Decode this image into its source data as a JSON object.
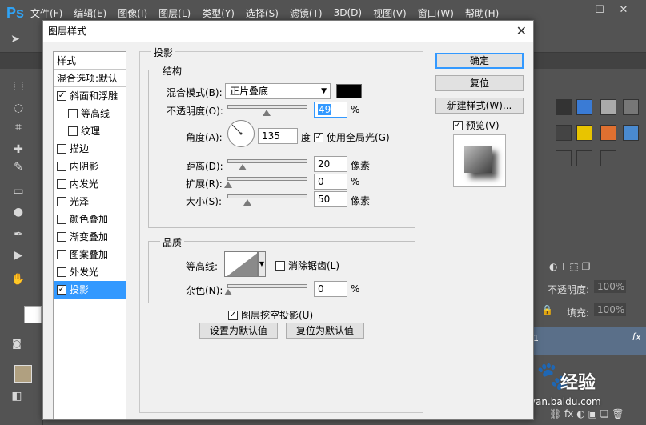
{
  "app": {
    "logo": "Ps",
    "menu": [
      "文件(F)",
      "编辑(E)",
      "图像(I)",
      "图层(L)",
      "类型(Y)",
      "选择(S)",
      "滤镜(T)",
      "3D(D)",
      "视图(V)",
      "窗口(W)",
      "帮助(H)"
    ]
  },
  "layers_panel": {
    "opacity_label": "不透明度:",
    "opacity_value": "100%",
    "fill_label": "填充:",
    "fill_value": "100%",
    "fx_label": "fx",
    "layer_num": "1",
    "swatch_fg_color": "#b0a080"
  },
  "watermark": {
    "brand": "经验",
    "url": "jingyan.baidu.com"
  },
  "dialog": {
    "title": "图层样式",
    "close_glyph": "✕",
    "style_list": [
      {
        "label": "样式",
        "checkbox": false,
        "checked": false,
        "indent": false
      },
      {
        "label": "混合选项:默认",
        "checkbox": false,
        "checked": false,
        "indent": false
      },
      {
        "label": "斜面和浮雕",
        "checkbox": true,
        "checked": true,
        "indent": false
      },
      {
        "label": "等高线",
        "checkbox": true,
        "checked": false,
        "indent": true
      },
      {
        "label": "纹理",
        "checkbox": true,
        "checked": false,
        "indent": true
      },
      {
        "label": "描边",
        "checkbox": true,
        "checked": false,
        "indent": false
      },
      {
        "label": "内阴影",
        "checkbox": true,
        "checked": false,
        "indent": false
      },
      {
        "label": "内发光",
        "checkbox": true,
        "checked": false,
        "indent": false
      },
      {
        "label": "光泽",
        "checkbox": true,
        "checked": false,
        "indent": false
      },
      {
        "label": "颜色叠加",
        "checkbox": true,
        "checked": false,
        "indent": false
      },
      {
        "label": "渐变叠加",
        "checkbox": true,
        "checked": false,
        "indent": false
      },
      {
        "label": "图案叠加",
        "checkbox": true,
        "checked": false,
        "indent": false
      },
      {
        "label": "外发光",
        "checkbox": true,
        "checked": false,
        "indent": false
      },
      {
        "label": "投影",
        "checkbox": true,
        "checked": true,
        "indent": false,
        "selected": true
      }
    ],
    "drop_shadow": {
      "title": "投影",
      "structure": {
        "title": "结构",
        "blend_mode_label": "混合模式(B):",
        "blend_mode_value": "正片叠底",
        "shadow_color": "#000000",
        "opacity_label": "不透明度(O):",
        "opacity_value": "49",
        "opacity_unit": "%",
        "opacity_fraction": 0.49,
        "angle_label": "角度(A):",
        "angle_value": "135",
        "angle_unit": "度",
        "global_light_label": "使用全局光(G)",
        "global_light_checked": true,
        "distance_label": "距离(D):",
        "distance_value": "20",
        "distance_unit": "像素",
        "spread_label": "扩展(R):",
        "spread_value": "0",
        "spread_unit": "%",
        "size_label": "大小(S):",
        "size_value": "50",
        "size_unit": "像素"
      },
      "quality": {
        "title": "品质",
        "contour_label": "等高线:",
        "anti_alias_label": "消除锯齿(L)",
        "anti_alias_checked": false,
        "noise_label": "杂色(N):",
        "noise_value": "0",
        "noise_unit": "%"
      },
      "knockout_label": "图层挖空投影(U)",
      "knockout_checked": true,
      "set_default_label": "设置为默认值",
      "reset_default_label": "复位为默认值"
    },
    "buttons": {
      "ok": "确定",
      "reset": "复位",
      "new_style": "新建样式(W)...",
      "preview_label": "预览(V)",
      "preview_checked": true
    }
  }
}
